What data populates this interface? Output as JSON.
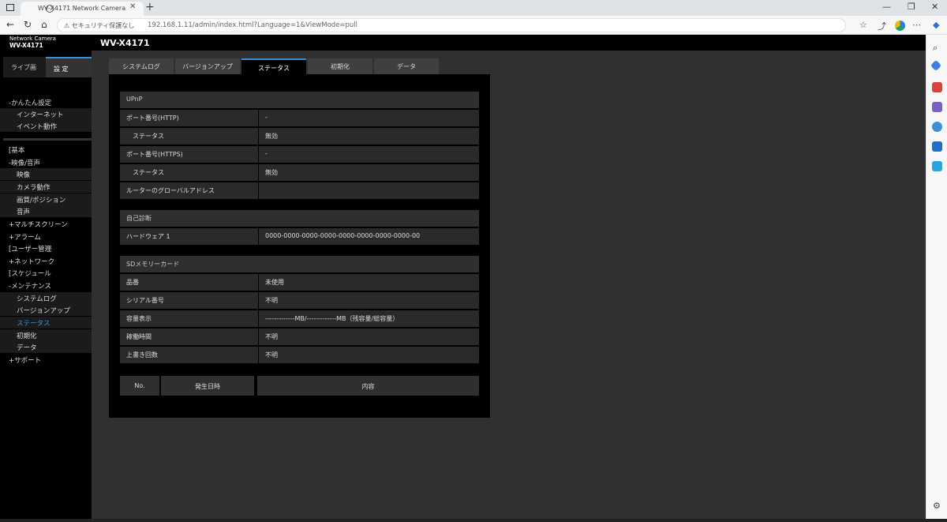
{
  "browser": {
    "tab_title": "WV-X4171 Network Camera",
    "security_label": "セキュリティ保護なし",
    "url": "192.168.1.11/admin/index.html?Language=1&ViewMode=pull"
  },
  "app": {
    "brand_line1": "Network Camera",
    "brand_line2": "WV-X4171",
    "model": "WV-X4171",
    "mode_tabs": {
      "live": "ライブ画",
      "settings": "設 定"
    }
  },
  "sidebar": {
    "items": [
      {
        "label": "-かんたん設定",
        "level": 0
      },
      {
        "label": "インターネット",
        "level": 1
      },
      {
        "label": "イベント動作",
        "level": 1
      },
      {
        "label": "[基本",
        "level": 0
      },
      {
        "label": "-映像/音声",
        "level": 0
      },
      {
        "label": "映像",
        "level": 1
      },
      {
        "label": "カメラ動作",
        "level": 1
      },
      {
        "label": "画質/ポジション",
        "level": 1
      },
      {
        "label": "音声",
        "level": 1
      },
      {
        "label": "+マルチスクリーン",
        "level": 0
      },
      {
        "label": "+アラーム",
        "level": 0
      },
      {
        "label": "[ユーザー管理",
        "level": 0
      },
      {
        "label": "+ネットワーク",
        "level": 0
      },
      {
        "label": "[スケジュール",
        "level": 0
      },
      {
        "label": "-メンテナンス",
        "level": 0
      },
      {
        "label": "システムログ",
        "level": 1
      },
      {
        "label": "バージョンアップ",
        "level": 1
      },
      {
        "label": "ステータス",
        "level": 1,
        "active": true
      },
      {
        "label": "初期化",
        "level": 1
      },
      {
        "label": "データ",
        "level": 1
      },
      {
        "label": "+サポート",
        "level": 0
      }
    ]
  },
  "content_tabs": [
    "システムログ",
    "バージョンアップ",
    "ステータス",
    "初期化",
    "データ"
  ],
  "active_tab": "ステータス",
  "sections": [
    {
      "title": "UPnP",
      "rows": [
        {
          "label": "ポート番号(HTTP)",
          "value": "-"
        },
        {
          "label": "ステータス",
          "value": "無効",
          "indent": true
        },
        {
          "label": "ポート番号(HTTPS)",
          "value": "-"
        },
        {
          "label": "ステータス",
          "value": "無効",
          "indent": true
        },
        {
          "label": "ルーターのグローバルアドレス",
          "value": ""
        }
      ]
    },
    {
      "title": "自己診断",
      "rows": [
        {
          "label": "ハードウェア 1",
          "value": "0000-0000-0000-0000-0000-0000-0000-0000-00"
        }
      ]
    },
    {
      "title": "SDメモリーカード",
      "rows": [
        {
          "label": "品番",
          "value": "未使用"
        },
        {
          "label": "シリアル番号",
          "value": "不明"
        },
        {
          "label": "容量表示",
          "value": "-------------MB/-------------MB（残容量/総容量）"
        },
        {
          "label": "稼働時間",
          "value": "不明"
        },
        {
          "label": "上書き回数",
          "value": "不明"
        }
      ]
    }
  ],
  "log_table": {
    "headers": [
      "No.",
      "発生日時",
      "内容"
    ]
  },
  "colors": {
    "accent": "#3a8fd8",
    "panel": "#000000",
    "background": "#303033"
  }
}
